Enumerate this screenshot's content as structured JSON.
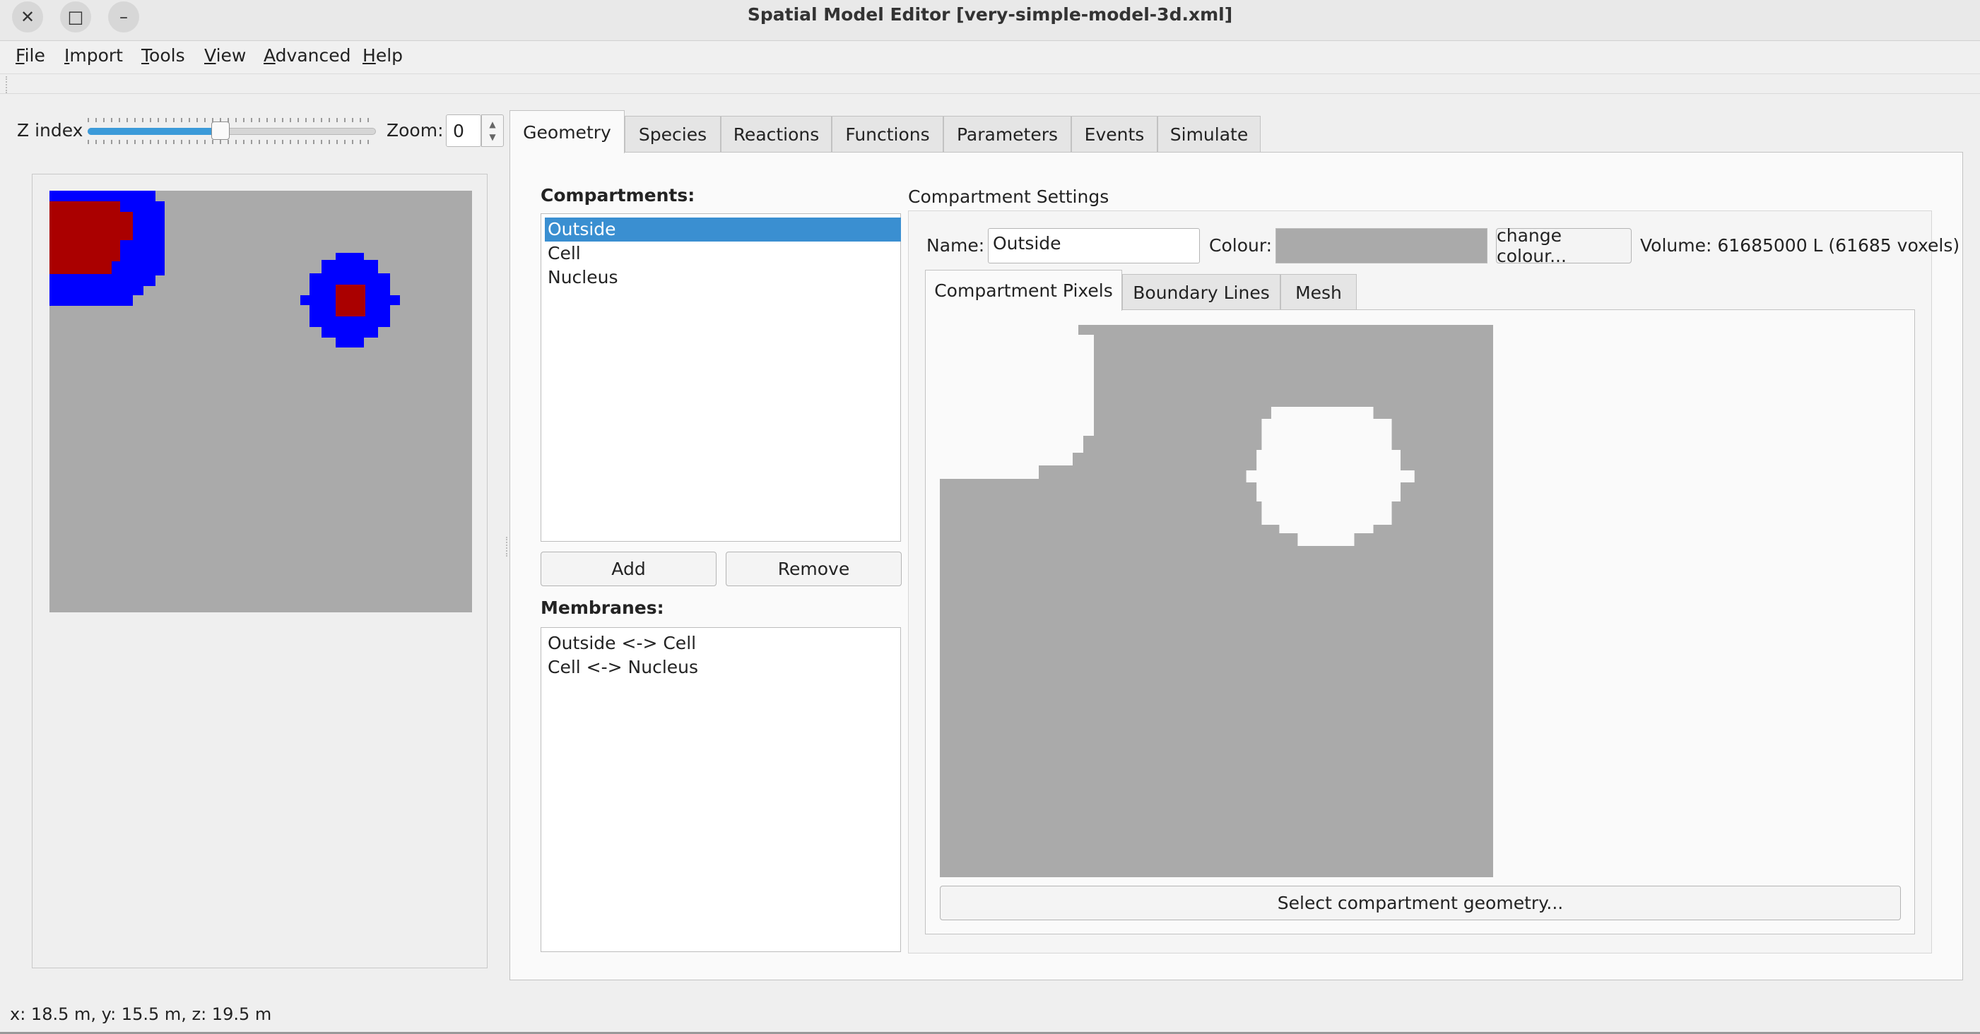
{
  "window": {
    "title": "Spatial Model Editor [very-simple-model-3d.xml]",
    "close_glyph": "✕",
    "maximize_glyph": "□",
    "minimize_glyph": "–"
  },
  "menu": [
    {
      "u": "F",
      "rest": "ile"
    },
    {
      "u": "I",
      "rest": "mport"
    },
    {
      "u": "T",
      "rest": "ools"
    },
    {
      "u": "V",
      "rest": "iew"
    },
    {
      "u": "A",
      "rest": "dvanced"
    },
    {
      "u": "H",
      "rest": "elp"
    }
  ],
  "toolbar": {
    "z_label": "Z index",
    "z_slider_fraction": 0.46,
    "zoom_label": "Zoom:",
    "zoom_value": "0",
    "spin_up": "▲",
    "spin_down": "▼"
  },
  "tabs": [
    "Geometry",
    "Species",
    "Reactions",
    "Functions",
    "Parameters",
    "Events",
    "Simulate"
  ],
  "active_tab": "Geometry",
  "compartments": {
    "label": "Compartments:",
    "items": [
      "Outside",
      "Cell",
      "Nucleus"
    ],
    "selected": "Outside",
    "add_label": "Add",
    "remove_label": "Remove"
  },
  "membranes": {
    "label": "Membranes:",
    "items": [
      "Outside <-> Cell",
      "Cell <-> Nucleus"
    ]
  },
  "settings": {
    "group_title": "Compartment Settings",
    "name_label": "Name:",
    "name_value": "Outside",
    "colour_label": "Colour:",
    "colour_value": "#aaaaaa",
    "change_colour_label": "change colour...",
    "volume_text": "Volume: 61685000 L (61685 voxels)",
    "subtabs": [
      "Compartment Pixels",
      "Boundary Lines",
      "Mesh"
    ],
    "active_subtab": "Compartment Pixels",
    "select_geometry_label": "Select compartment geometry..."
  },
  "colors": {
    "outside": "#aaaaaa",
    "cell": "#0000ff",
    "nucleus": "#aa0000",
    "selection": "#3a8fd1",
    "slider_fill": "#3b9ad9"
  },
  "statusbar": {
    "text": "x: 18.5 m, y: 15.5 m, z: 19.5 m"
  }
}
